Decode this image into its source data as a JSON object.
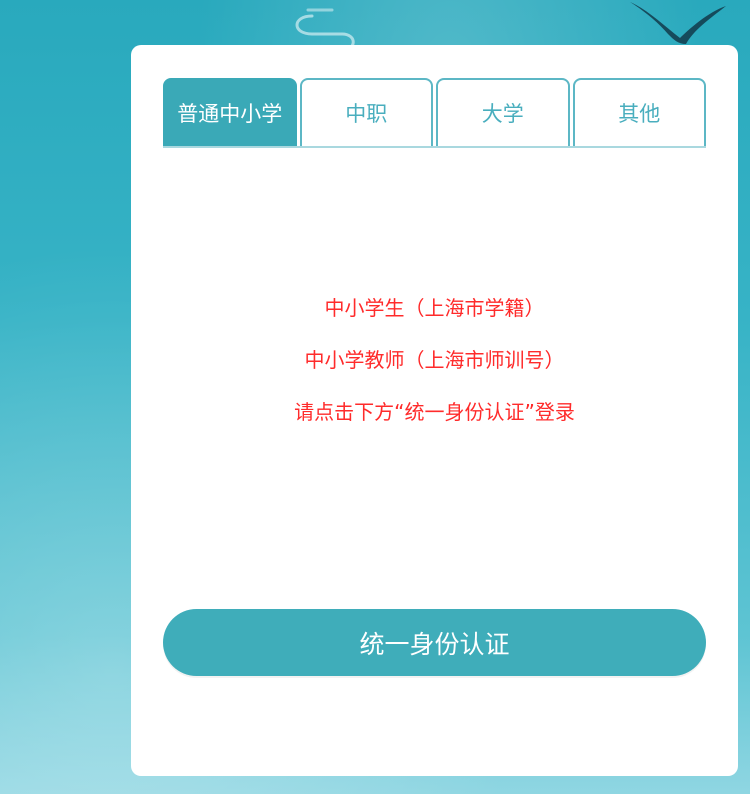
{
  "tabs": [
    {
      "label": "普通中小学",
      "active": true
    },
    {
      "label": "中职",
      "active": false
    },
    {
      "label": "大学",
      "active": false
    },
    {
      "label": "其他",
      "active": false
    }
  ],
  "notice": {
    "line1": "中小学生（上海市学籍）",
    "line2": "中小学教师（上海市师训号）",
    "line3": "请点击下方“统一身份认证”登录"
  },
  "auth_button_label": "统一身份认证",
  "colors": {
    "accent": "#3aa9b7",
    "notice_text": "#ff2b2b",
    "background": "#37b3c6"
  },
  "icons": {
    "swirl": "swirl-decoration-icon",
    "bird": "bird-decoration-icon"
  }
}
